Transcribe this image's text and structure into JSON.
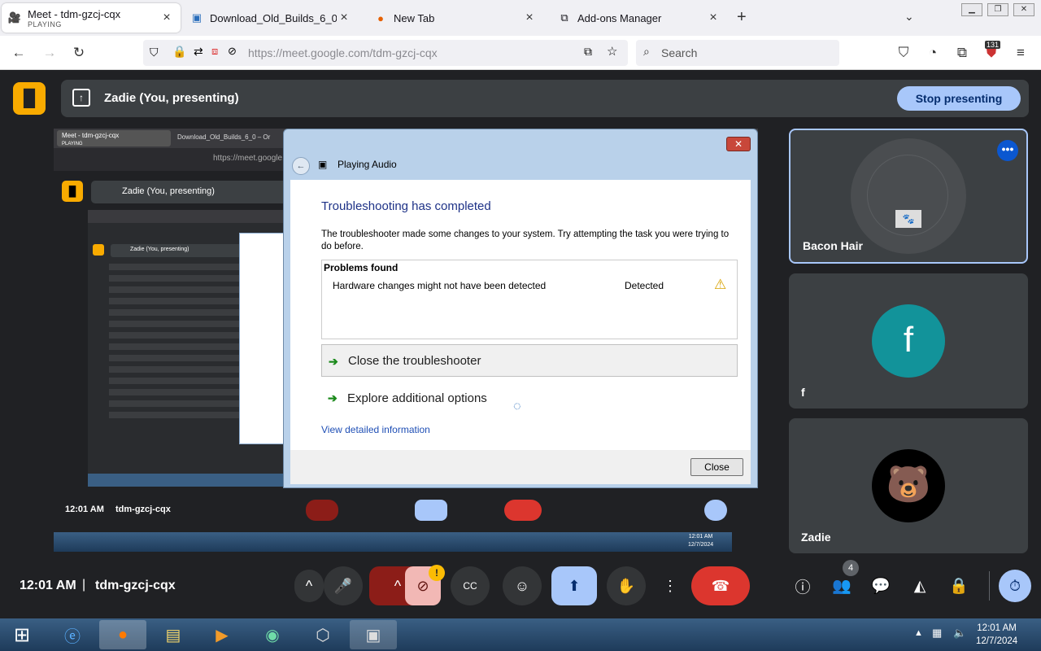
{
  "browser": {
    "tabs": [
      {
        "label": "Meet - tdm-gzcj-cqx",
        "sub": "PLAYING",
        "icon": "camera-icon"
      },
      {
        "label": "Download_Old_Builds_6_0 – Or",
        "icon": "doc-icon"
      },
      {
        "label": "New Tab",
        "icon": "firefox-icon"
      },
      {
        "label": "Add-ons Manager",
        "icon": "puzzle-icon"
      }
    ],
    "new_tab": "+",
    "url": "https://meet.google.com/tdm-gzcj-cqx",
    "search_placeholder": "Search",
    "badge": "131"
  },
  "meet": {
    "presenting_title": "Zadie (You, presenting)",
    "stop_label": "Stop presenting",
    "participants": [
      {
        "name": "Bacon Hair"
      },
      {
        "name": "f",
        "initial": "f",
        "color": "#12939a"
      },
      {
        "name": "Zadie"
      }
    ],
    "time": "12:01 AM",
    "separator": "|",
    "meeting_code": "tdm-gzcj-cqx",
    "people_count": "4",
    "alert_badge": "!"
  },
  "shared": {
    "time": "12:01 AM",
    "meeting_code": "tdm-gzcj-cqx",
    "tab1": "Meet - tdm-gzcj-cqx",
    "tab1_sub": "PLAYING",
    "tab2": "Download_Old_Builds_6_0 – Or",
    "url": "https://meet.google.c",
    "presenting": "Zadie (You, presenting)",
    "nested_title": "Zadie (You, presenting)",
    "tray_time": "12:01 AM",
    "tray_date": "12/7/2024"
  },
  "dialog": {
    "window_title": "Playing Audio",
    "heading": "Troubleshooting has completed",
    "paragraph": "The troubleshooter made some changes to your system. Try attempting the task you were trying to do before.",
    "problems_header": "Problems found",
    "problem": "Hardware changes might not have been detected",
    "problem_status": "Detected",
    "option1": "Close the troubleshooter",
    "option2": "Explore additional options",
    "link": "View detailed information",
    "close": "Close"
  },
  "taskbar": {
    "time": "12:01 AM",
    "date": "12/7/2024"
  },
  "colors": {
    "accent": "#a8c7fa",
    "end_call": "#dc362e",
    "present_active": "#a8c7fa"
  }
}
